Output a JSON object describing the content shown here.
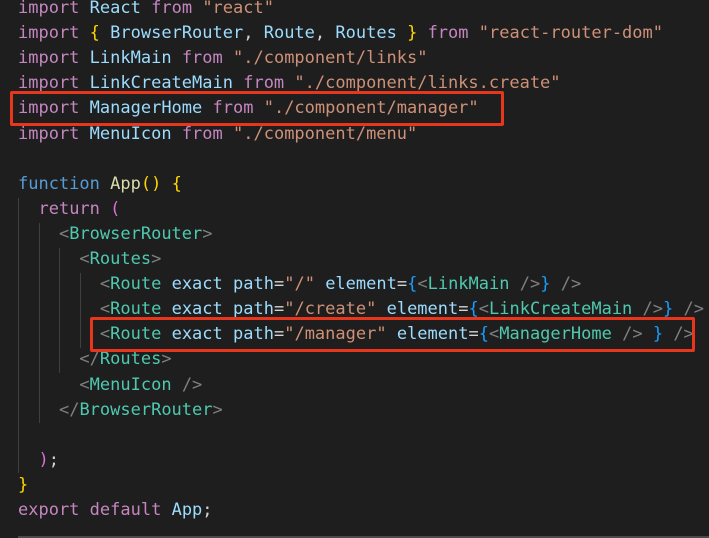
{
  "colors": {
    "background": "#1e1e1e",
    "keyword": "#c586c0",
    "storage": "#569cd6",
    "variable": "#9cdcfe",
    "function": "#dcdcaa",
    "string": "#ce9178",
    "tag": "#4ec9b0",
    "attribute": "#9cdcfe",
    "bracket_gold": "#ffd700",
    "bracket_purple": "#da70d6",
    "bracket_blue": "#179fff",
    "punctuation": "#d4d4d4",
    "tag_punctuation": "#808080",
    "highlight_box": "#e8361c"
  },
  "code": {
    "lines": [
      {
        "tokens": [
          {
            "text": "import",
            "color": "#c586c0"
          },
          {
            "text": " ",
            "color": "#d4d4d4"
          },
          {
            "text": "React",
            "color": "#9cdcfe"
          },
          {
            "text": " ",
            "color": "#d4d4d4"
          },
          {
            "text": "from",
            "color": "#c586c0"
          },
          {
            "text": " ",
            "color": "#d4d4d4"
          },
          {
            "text": "\"react\"",
            "color": "#ce9178"
          }
        ]
      },
      {
        "tokens": [
          {
            "text": "import",
            "color": "#c586c0"
          },
          {
            "text": " ",
            "color": "#d4d4d4"
          },
          {
            "text": "{",
            "color": "#ffd700"
          },
          {
            "text": " ",
            "color": "#d4d4d4"
          },
          {
            "text": "BrowserRouter",
            "color": "#9cdcfe"
          },
          {
            "text": ", ",
            "color": "#d4d4d4"
          },
          {
            "text": "Route",
            "color": "#9cdcfe"
          },
          {
            "text": ", ",
            "color": "#d4d4d4"
          },
          {
            "text": "Routes",
            "color": "#9cdcfe"
          },
          {
            "text": " ",
            "color": "#d4d4d4"
          },
          {
            "text": "}",
            "color": "#ffd700"
          },
          {
            "text": " ",
            "color": "#d4d4d4"
          },
          {
            "text": "from",
            "color": "#c586c0"
          },
          {
            "text": " ",
            "color": "#d4d4d4"
          },
          {
            "text": "\"react-router-dom\"",
            "color": "#ce9178"
          }
        ]
      },
      {
        "tokens": [
          {
            "text": "import",
            "color": "#c586c0"
          },
          {
            "text": " ",
            "color": "#d4d4d4"
          },
          {
            "text": "LinkMain",
            "color": "#9cdcfe"
          },
          {
            "text": " ",
            "color": "#d4d4d4"
          },
          {
            "text": "from",
            "color": "#c586c0"
          },
          {
            "text": " ",
            "color": "#d4d4d4"
          },
          {
            "text": "\"./component/links\"",
            "color": "#ce9178"
          }
        ]
      },
      {
        "tokens": [
          {
            "text": "import",
            "color": "#c586c0"
          },
          {
            "text": " ",
            "color": "#d4d4d4"
          },
          {
            "text": "LinkCreateMain",
            "color": "#9cdcfe"
          },
          {
            "text": " ",
            "color": "#d4d4d4"
          },
          {
            "text": "from",
            "color": "#c586c0"
          },
          {
            "text": " ",
            "color": "#d4d4d4"
          },
          {
            "text": "\"./component/links.create\"",
            "color": "#ce9178"
          }
        ]
      },
      {
        "tokens": [
          {
            "text": "import",
            "color": "#c586c0"
          },
          {
            "text": " ",
            "color": "#d4d4d4"
          },
          {
            "text": "ManagerHome",
            "color": "#9cdcfe"
          },
          {
            "text": " ",
            "color": "#d4d4d4"
          },
          {
            "text": "from",
            "color": "#c586c0"
          },
          {
            "text": " ",
            "color": "#d4d4d4"
          },
          {
            "text": "\"./component/manager\"",
            "color": "#ce9178"
          }
        ]
      },
      {
        "tokens": [
          {
            "text": "import",
            "color": "#c586c0"
          },
          {
            "text": " ",
            "color": "#d4d4d4"
          },
          {
            "text": "MenuIcon",
            "color": "#9cdcfe"
          },
          {
            "text": " ",
            "color": "#d4d4d4"
          },
          {
            "text": "from",
            "color": "#c586c0"
          },
          {
            "text": " ",
            "color": "#d4d4d4"
          },
          {
            "text": "\"./component/menu\"",
            "color": "#ce9178"
          }
        ]
      },
      {
        "tokens": []
      },
      {
        "tokens": [
          {
            "text": "function",
            "color": "#569cd6"
          },
          {
            "text": " ",
            "color": "#d4d4d4"
          },
          {
            "text": "App",
            "color": "#dcdcaa"
          },
          {
            "text": "()",
            "color": "#ffd700"
          },
          {
            "text": " ",
            "color": "#d4d4d4"
          },
          {
            "text": "{",
            "color": "#ffd700"
          }
        ]
      },
      {
        "tokens": [
          {
            "text": "  ",
            "color": "#d4d4d4"
          },
          {
            "text": "return",
            "color": "#c586c0"
          },
          {
            "text": " ",
            "color": "#d4d4d4"
          },
          {
            "text": "(",
            "color": "#da70d6"
          }
        ]
      },
      {
        "tokens": [
          {
            "text": "    ",
            "color": "#d4d4d4"
          },
          {
            "text": "<",
            "color": "#808080"
          },
          {
            "text": "BrowserRouter",
            "color": "#4ec9b0"
          },
          {
            "text": ">",
            "color": "#808080"
          }
        ]
      },
      {
        "tokens": [
          {
            "text": "      ",
            "color": "#d4d4d4"
          },
          {
            "text": "<",
            "color": "#808080"
          },
          {
            "text": "Routes",
            "color": "#4ec9b0"
          },
          {
            "text": ">",
            "color": "#808080"
          }
        ]
      },
      {
        "tokens": [
          {
            "text": "        ",
            "color": "#d4d4d4"
          },
          {
            "text": "<",
            "color": "#808080"
          },
          {
            "text": "Route",
            "color": "#4ec9b0"
          },
          {
            "text": " ",
            "color": "#d4d4d4"
          },
          {
            "text": "exact",
            "color": "#9cdcfe"
          },
          {
            "text": " ",
            "color": "#d4d4d4"
          },
          {
            "text": "path",
            "color": "#9cdcfe"
          },
          {
            "text": "=",
            "color": "#d4d4d4"
          },
          {
            "text": "\"/\"",
            "color": "#ce9178"
          },
          {
            "text": " ",
            "color": "#d4d4d4"
          },
          {
            "text": "element",
            "color": "#9cdcfe"
          },
          {
            "text": "=",
            "color": "#d4d4d4"
          },
          {
            "text": "{",
            "color": "#179fff"
          },
          {
            "text": "<",
            "color": "#808080"
          },
          {
            "text": "LinkMain",
            "color": "#4ec9b0"
          },
          {
            "text": " ",
            "color": "#d4d4d4"
          },
          {
            "text": "/>",
            "color": "#808080"
          },
          {
            "text": "}",
            "color": "#179fff"
          },
          {
            "text": " ",
            "color": "#d4d4d4"
          },
          {
            "text": "/>",
            "color": "#808080"
          }
        ]
      },
      {
        "tokens": [
          {
            "text": "        ",
            "color": "#d4d4d4"
          },
          {
            "text": "<",
            "color": "#808080"
          },
          {
            "text": "Route",
            "color": "#4ec9b0"
          },
          {
            "text": " ",
            "color": "#d4d4d4"
          },
          {
            "text": "exact",
            "color": "#9cdcfe"
          },
          {
            "text": " ",
            "color": "#d4d4d4"
          },
          {
            "text": "path",
            "color": "#9cdcfe"
          },
          {
            "text": "=",
            "color": "#d4d4d4"
          },
          {
            "text": "\"/create\"",
            "color": "#ce9178"
          },
          {
            "text": " ",
            "color": "#d4d4d4"
          },
          {
            "text": "element",
            "color": "#9cdcfe"
          },
          {
            "text": "=",
            "color": "#d4d4d4"
          },
          {
            "text": "{",
            "color": "#179fff"
          },
          {
            "text": "<",
            "color": "#808080"
          },
          {
            "text": "LinkCreateMain",
            "color": "#4ec9b0"
          },
          {
            "text": " ",
            "color": "#d4d4d4"
          },
          {
            "text": "/>",
            "color": "#808080"
          },
          {
            "text": "}",
            "color": "#179fff"
          },
          {
            "text": " ",
            "color": "#d4d4d4"
          },
          {
            "text": "/>",
            "color": "#808080"
          }
        ]
      },
      {
        "tokens": [
          {
            "text": "        ",
            "color": "#d4d4d4"
          },
          {
            "text": "<",
            "color": "#808080"
          },
          {
            "text": "Route",
            "color": "#4ec9b0"
          },
          {
            "text": " ",
            "color": "#d4d4d4"
          },
          {
            "text": "exact",
            "color": "#9cdcfe"
          },
          {
            "text": " ",
            "color": "#d4d4d4"
          },
          {
            "text": "path",
            "color": "#9cdcfe"
          },
          {
            "text": "=",
            "color": "#d4d4d4"
          },
          {
            "text": "\"/manager\"",
            "color": "#ce9178"
          },
          {
            "text": " ",
            "color": "#d4d4d4"
          },
          {
            "text": "element",
            "color": "#9cdcfe"
          },
          {
            "text": "=",
            "color": "#d4d4d4"
          },
          {
            "text": "{",
            "color": "#179fff"
          },
          {
            "text": "<",
            "color": "#808080"
          },
          {
            "text": "ManagerHome",
            "color": "#4ec9b0"
          },
          {
            "text": " ",
            "color": "#d4d4d4"
          },
          {
            "text": "/>",
            "color": "#808080"
          },
          {
            "text": " ",
            "color": "#d4d4d4"
          },
          {
            "text": "}",
            "color": "#179fff"
          },
          {
            "text": " ",
            "color": "#d4d4d4"
          },
          {
            "text": "/>",
            "color": "#808080"
          }
        ]
      },
      {
        "tokens": [
          {
            "text": "      ",
            "color": "#d4d4d4"
          },
          {
            "text": "</",
            "color": "#808080"
          },
          {
            "text": "Routes",
            "color": "#4ec9b0"
          },
          {
            "text": ">",
            "color": "#808080"
          }
        ]
      },
      {
        "tokens": [
          {
            "text": "      ",
            "color": "#d4d4d4"
          },
          {
            "text": "<",
            "color": "#808080"
          },
          {
            "text": "MenuIcon",
            "color": "#4ec9b0"
          },
          {
            "text": " ",
            "color": "#d4d4d4"
          },
          {
            "text": "/>",
            "color": "#808080"
          }
        ]
      },
      {
        "tokens": [
          {
            "text": "    ",
            "color": "#d4d4d4"
          },
          {
            "text": "</",
            "color": "#808080"
          },
          {
            "text": "BrowserRouter",
            "color": "#4ec9b0"
          },
          {
            "text": ">",
            "color": "#808080"
          }
        ]
      },
      {
        "tokens": []
      },
      {
        "tokens": [
          {
            "text": "  ",
            "color": "#d4d4d4"
          },
          {
            "text": ")",
            "color": "#da70d6"
          },
          {
            "text": ";",
            "color": "#d4d4d4"
          }
        ]
      },
      {
        "tokens": [
          {
            "text": "}",
            "color": "#ffd700"
          }
        ]
      },
      {
        "tokens": [
          {
            "text": "export",
            "color": "#c586c0"
          },
          {
            "text": " ",
            "color": "#d4d4d4"
          },
          {
            "text": "default",
            "color": "#c586c0"
          },
          {
            "text": " ",
            "color": "#d4d4d4"
          },
          {
            "text": "App",
            "color": "#9cdcfe"
          },
          {
            "text": ";",
            "color": "#d4d4d4"
          }
        ]
      }
    ]
  }
}
